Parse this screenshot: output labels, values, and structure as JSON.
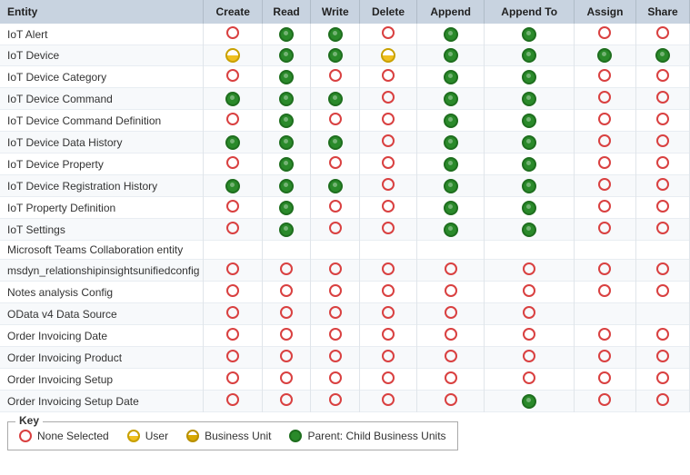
{
  "table": {
    "headers": [
      "Entity",
      "Create",
      "Read",
      "Write",
      "Delete",
      "Append",
      "Append To",
      "Assign",
      "Share"
    ],
    "rows": [
      {
        "entity": "IoT Alert",
        "cols": [
          "none",
          "green",
          "green",
          "none",
          "green",
          "green",
          "none",
          "none"
        ]
      },
      {
        "entity": "IoT Device",
        "cols": [
          "user",
          "green",
          "green",
          "user",
          "green",
          "green",
          "green",
          "green"
        ]
      },
      {
        "entity": "IoT Device Category",
        "cols": [
          "none",
          "green",
          "none",
          "none",
          "green",
          "green",
          "none",
          "none"
        ]
      },
      {
        "entity": "IoT Device Command",
        "cols": [
          "green",
          "green",
          "green",
          "none",
          "green",
          "green",
          "none",
          "none"
        ]
      },
      {
        "entity": "IoT Device Command Definition",
        "cols": [
          "none",
          "green",
          "none",
          "none",
          "green",
          "green",
          "none",
          "none"
        ]
      },
      {
        "entity": "IoT Device Data History",
        "cols": [
          "green",
          "green",
          "green",
          "none",
          "green",
          "green",
          "none",
          "none"
        ]
      },
      {
        "entity": "IoT Device Property",
        "cols": [
          "none",
          "green",
          "none",
          "none",
          "green",
          "green",
          "none",
          "none"
        ]
      },
      {
        "entity": "IoT Device Registration History",
        "cols": [
          "green",
          "green",
          "green",
          "none",
          "green",
          "green",
          "none",
          "none"
        ]
      },
      {
        "entity": "IoT Property Definition",
        "cols": [
          "none",
          "green",
          "none",
          "none",
          "green",
          "green",
          "none",
          "none"
        ]
      },
      {
        "entity": "IoT Settings",
        "cols": [
          "none",
          "green",
          "none",
          "none",
          "green",
          "green",
          "none",
          "none"
        ]
      },
      {
        "entity": "Microsoft Teams Collaboration entity",
        "cols": [
          "",
          "",
          "",
          "",
          "",
          "",
          "",
          ""
        ]
      },
      {
        "entity": "msdyn_relationshipinsightsunifiedconfig",
        "cols": [
          "none",
          "none",
          "none",
          "none",
          "none",
          "none",
          "none",
          "none"
        ]
      },
      {
        "entity": "Notes analysis Config",
        "cols": [
          "none",
          "none",
          "none",
          "none",
          "none",
          "none",
          "none",
          "none"
        ]
      },
      {
        "entity": "OData v4 Data Source",
        "cols": [
          "none",
          "none",
          "none",
          "none",
          "none",
          "none",
          "",
          ""
        ]
      },
      {
        "entity": "Order Invoicing Date",
        "cols": [
          "none",
          "none",
          "none",
          "none",
          "none",
          "none",
          "none",
          "none"
        ]
      },
      {
        "entity": "Order Invoicing Product",
        "cols": [
          "none",
          "none",
          "none",
          "none",
          "none",
          "none",
          "none",
          "none"
        ]
      },
      {
        "entity": "Order Invoicing Setup",
        "cols": [
          "none",
          "none",
          "none",
          "none",
          "none",
          "none",
          "none",
          "none"
        ]
      },
      {
        "entity": "Order Invoicing Setup Date",
        "cols": [
          "none",
          "none",
          "none",
          "none",
          "none",
          "green",
          "none",
          "none"
        ]
      }
    ]
  },
  "key": {
    "title": "Key",
    "items": [
      {
        "label": "None Selected",
        "type": "none"
      },
      {
        "label": "User",
        "type": "user"
      },
      {
        "label": "Business Unit",
        "type": "bizunit"
      },
      {
        "label": "Parent: Child Business Units",
        "type": "parent"
      }
    ]
  }
}
